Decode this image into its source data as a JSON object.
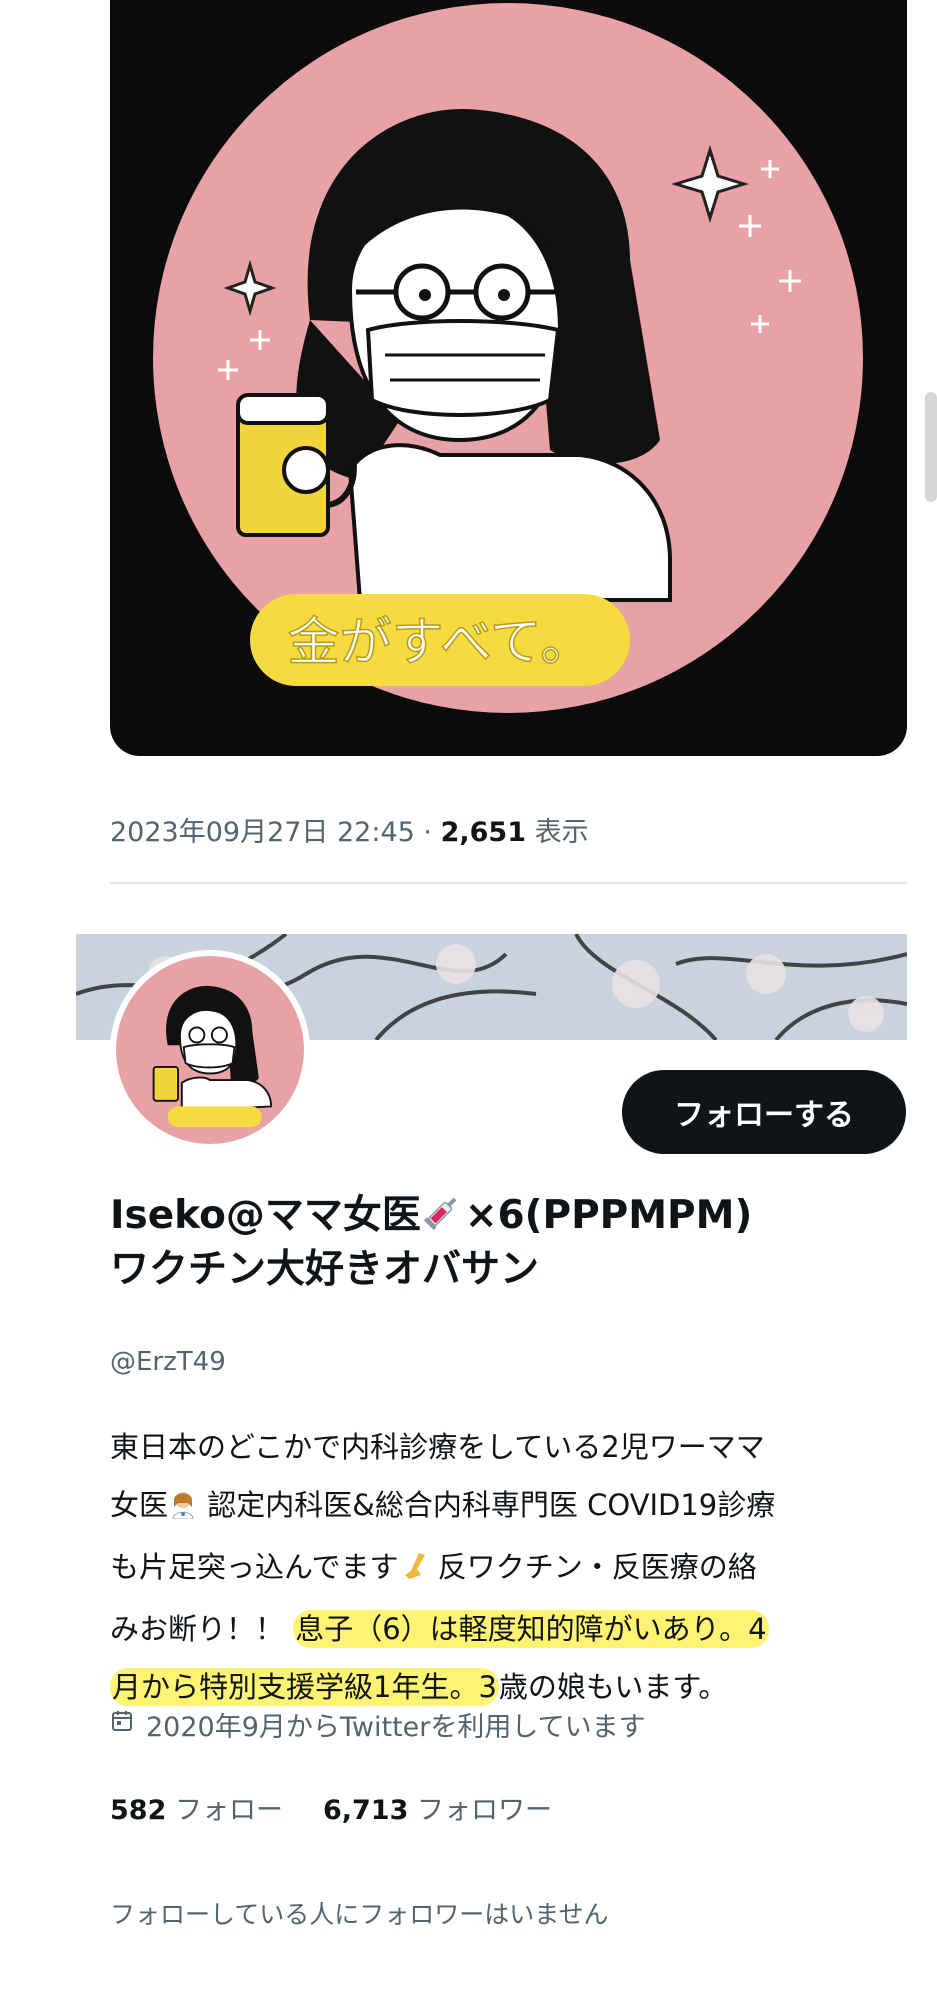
{
  "post": {
    "image_caption": "金がすべて。",
    "timestamp": "2023年09月27日 22:45",
    "views_count": "2,651",
    "views_label": "表示"
  },
  "profile": {
    "follow_button": "フォローする",
    "name_prefix": "Iseko@ママ女医",
    "name_suffix": "×6(PPPMPM)",
    "name_line2": "ワクチン大好きオバサン",
    "handle": "@ErzT49",
    "bio_1": "東日本のどこかで内科診療をしている2児ワーママ",
    "bio_2": "女医",
    "bio_3": " 認定内科医&総合内科専門医 COVID19診療",
    "bio_4": "も片足突っ込んでます",
    "bio_5": " 反ワクチン・反医療の絡",
    "bio_6": "みお断り！！ ",
    "bio_hl_1": "息子（6）は軽度知的障がいあり。4",
    "bio_hl_2": "月から特別支援学級1年生。3",
    "bio_7": "歳の娘もいます。",
    "joined": "2020年9月からTwitterを利用しています",
    "following_count": "582",
    "following_label": "フォロー",
    "followers_count": "6,713",
    "followers_label": "フォロワー",
    "followers_you_know": "フォローしている人にフォロワーはいません"
  },
  "colors": {
    "avatar_pink": "#e8a2a5",
    "highlight_yellow": "#ffec28",
    "button_black": "#0f1419"
  }
}
